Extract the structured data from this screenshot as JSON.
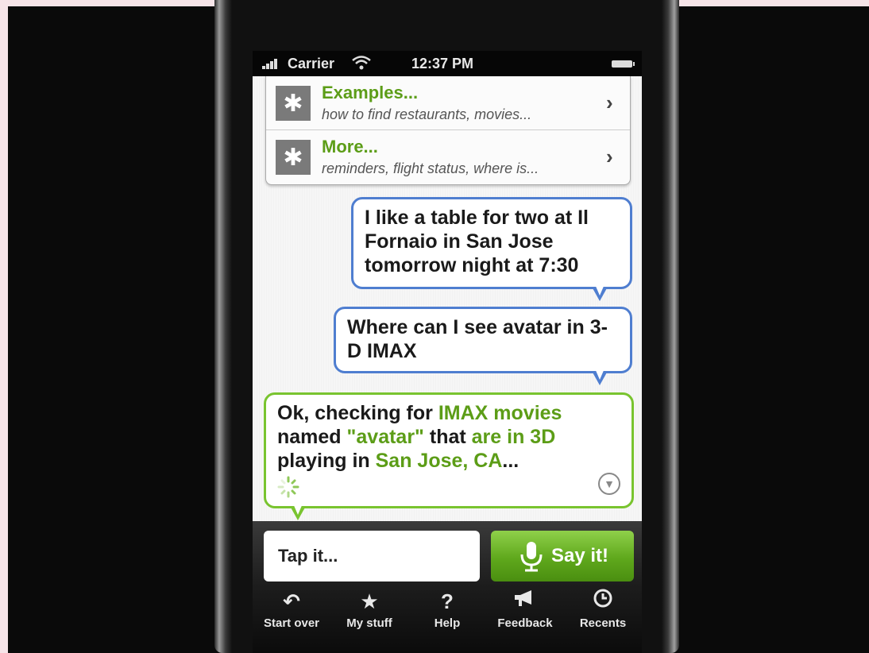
{
  "status_bar": {
    "carrier": "Carrier",
    "time": "12:37 PM",
    "icons": [
      "signal-bars-icon",
      "wifi-icon",
      "battery-icon"
    ]
  },
  "menu": {
    "items": [
      {
        "title": "Examples...",
        "subtitle": "how to find restaurants, movies...",
        "icon": "asterisk-icon"
      },
      {
        "title": "More...",
        "subtitle": "reminders, flight status, where is...",
        "icon": "asterisk-icon"
      }
    ]
  },
  "conversation": {
    "user_messages": [
      "I like a table for two at Il Fornaio in San Jose tomorrow night at 7:30",
      "Where can I see avatar in 3-D IMAX"
    ],
    "assistant_reply": {
      "parts": [
        "Ok, checking for ",
        "IMAX movies",
        " named ",
        "\"avatar\"",
        " that ",
        "are in 3D",
        " playing in ",
        "San Jose, CA",
        "..."
      ]
    }
  },
  "input": {
    "placeholder": "Tap it..."
  },
  "say_button": {
    "label": "Say it!"
  },
  "tabs": [
    {
      "label": "Start over",
      "icon": "undo-arrow-icon"
    },
    {
      "label": "My stuff",
      "icon": "star-icon"
    },
    {
      "label": "Help",
      "icon": "question-mark-icon"
    },
    {
      "label": "Feedback",
      "icon": "megaphone-icon"
    },
    {
      "label": "Recents",
      "icon": "clock-icon"
    }
  ],
  "colors": {
    "accent_green": "#5c9d17",
    "user_bubble_border": "#4f7ed0",
    "assistant_bubble_border": "#79c42f"
  }
}
